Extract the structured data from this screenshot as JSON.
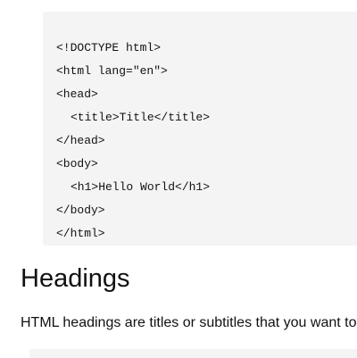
{
  "code_example": {
    "lines": [
      "<!DOCTYPE html>",
      "<html lang=\"en\">",
      "<head>",
      "<title>Title</title>",
      "</head>",
      "<body>",
      "<h1>Hello World</h1>",
      "</body>",
      "</html>"
    ]
  },
  "headings_section": {
    "title": "Headings",
    "text": "HTML headings are titles or subtitles that you want to"
  },
  "colors": {
    "code_background": "#f4f4f4",
    "text": "#111111"
  }
}
